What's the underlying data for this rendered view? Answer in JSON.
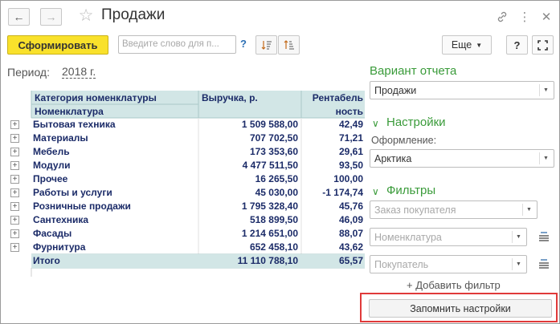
{
  "window": {
    "title": "Продажи"
  },
  "toolbar": {
    "generate_label": "Сформировать",
    "search_placeholder": "Введите слово для п...",
    "help_label": "?",
    "more_label": "Еще",
    "help_button_label": "?"
  },
  "period": {
    "label": "Период:",
    "value": "2018 г."
  },
  "report": {
    "header": {
      "category": "Категория номенклатуры",
      "nomenclature": "Номенклатура",
      "revenue": "Выручка, р.",
      "profitability_line1": "Рентабель",
      "profitability_line2": "ность"
    },
    "rows": [
      {
        "name": "Бытовая техника",
        "revenue": "1 509 588,00",
        "profit": "42,49"
      },
      {
        "name": "Материалы",
        "revenue": "707 702,50",
        "profit": "71,21"
      },
      {
        "name": "Мебель",
        "revenue": "173 353,60",
        "profit": "29,61"
      },
      {
        "name": "Модули",
        "revenue": "4 477 511,50",
        "profit": "93,50"
      },
      {
        "name": "Прочее",
        "revenue": "16 265,50",
        "profit": "100,00"
      },
      {
        "name": "Работы и услуги",
        "revenue": "45 030,00",
        "profit": "-1 174,74"
      },
      {
        "name": "Розничные продажи",
        "revenue": "1 795 328,40",
        "profit": "45,76"
      },
      {
        "name": "Сантехника",
        "revenue": "518 899,50",
        "profit": "46,09"
      },
      {
        "name": "Фасады",
        "revenue": "1 214 651,00",
        "profit": "88,07"
      },
      {
        "name": "Фурнитура",
        "revenue": "652 458,10",
        "profit": "43,62"
      }
    ],
    "total": {
      "name": "Итого",
      "revenue": "11 110 788,10",
      "profit": "65,57"
    }
  },
  "panel": {
    "variant_title": "Вариант отчета",
    "variant_value": "Продажи",
    "settings_title": "Настройки",
    "design_label": "Оформление:",
    "design_value": "Арктика",
    "filters_title": "Фильтры",
    "filter_order_placeholder": "Заказ покупателя",
    "filter_nomenclature_placeholder": "Номенклатура",
    "filter_buyer_placeholder": "Покупатель",
    "add_filter_label": "+ Добавить фильтр",
    "save_settings_label": "Запомнить настройки"
  }
}
